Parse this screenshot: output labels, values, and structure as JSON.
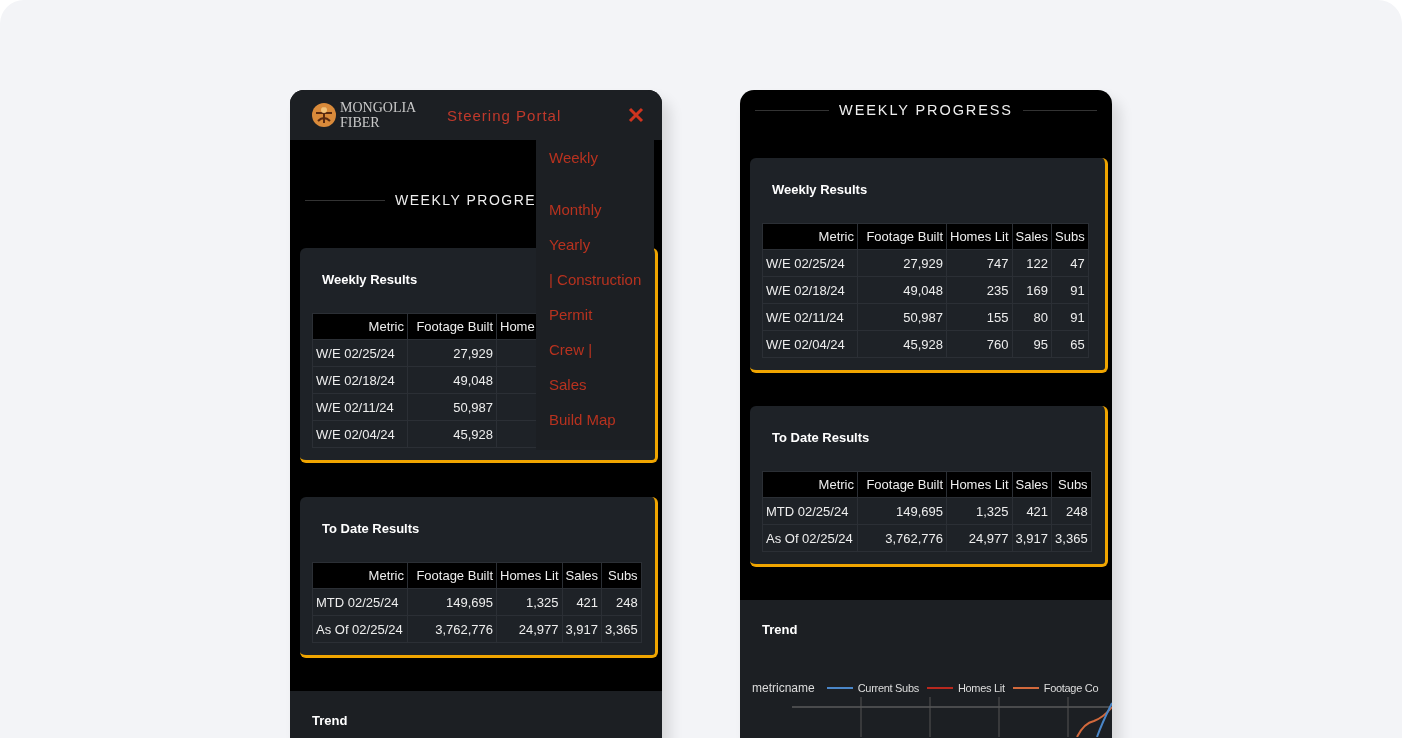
{
  "left_screen": {
    "header": {
      "logo_lines": [
        "MONGOLIA",
        "FIBER"
      ],
      "title": "Steering Portal"
    },
    "menu": [
      "Weekly",
      "Monthly",
      "Yearly",
      "| Construction",
      "Permit",
      "Crew |",
      "Sales",
      "Build Map"
    ],
    "page_title": "WEEKLY PROGRE",
    "sections": [
      {
        "title": "Weekly Results",
        "table": {
          "columns": [
            "Metric",
            "Footage Built",
            "Home"
          ],
          "rows": [
            [
              "W/E 02/25/24",
              "27,929"
            ],
            [
              "W/E 02/18/24",
              "49,048"
            ],
            [
              "W/E 02/11/24",
              "50,987"
            ],
            [
              "W/E 02/04/24",
              "45,928"
            ]
          ]
        }
      },
      {
        "title": "To Date Results",
        "table": {
          "columns": [
            "Metric",
            "Footage Built",
            "Homes Lit",
            "Sales",
            "Subs"
          ],
          "rows": [
            [
              "MTD 02/25/24",
              "149,695",
              "1,325",
              "421",
              "248"
            ],
            [
              "As Of 02/25/24",
              "3,762,776",
              "24,977",
              "3,917",
              "3,365"
            ]
          ]
        }
      }
    ],
    "trend": {
      "title": "Trend"
    }
  },
  "right_screen": {
    "page_title": "WEEKLY PROGRESS",
    "sections": [
      {
        "title": "Weekly Results",
        "table": {
          "columns": [
            "Metric",
            "Footage Built",
            "Homes Lit",
            "Sales",
            "Subs"
          ],
          "rows": [
            [
              "W/E 02/25/24",
              "27,929",
              "747",
              "122",
              "47"
            ],
            [
              "W/E 02/18/24",
              "49,048",
              "235",
              "169",
              "91"
            ],
            [
              "W/E 02/11/24",
              "50,987",
              "155",
              "80",
              "91"
            ],
            [
              "W/E 02/04/24",
              "45,928",
              "760",
              "95",
              "65"
            ]
          ]
        }
      },
      {
        "title": "To Date Results",
        "table": {
          "columns": [
            "Metric",
            "Footage Built",
            "Homes Lit",
            "Sales",
            "Subs"
          ],
          "rows": [
            [
              "MTD 02/25/24",
              "149,695",
              "1,325",
              "421",
              "248"
            ],
            [
              "As Of 02/25/24",
              "3,762,776",
              "24,977",
              "3,917",
              "3,365"
            ]
          ]
        }
      }
    ],
    "trend": {
      "title": "Trend",
      "legend_title": "metricname",
      "legend": [
        {
          "label": "Current Subs",
          "color": "#4a86c8"
        },
        {
          "label": "Homes Lit",
          "color": "#b8281e"
        },
        {
          "label": "Footage Co",
          "color": "#d2693c"
        }
      ]
    }
  }
}
